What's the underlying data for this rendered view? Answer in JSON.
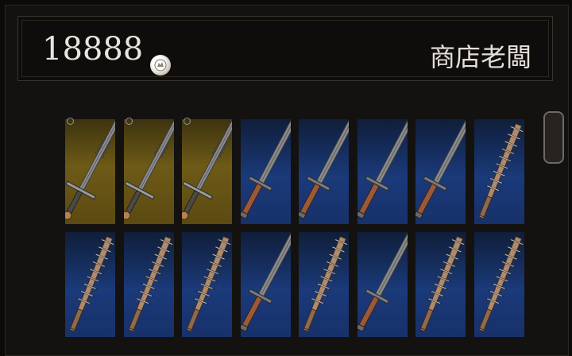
{
  "header": {
    "currency_amount": "18888",
    "currency_icon": "souls-coin-icon",
    "shop_name": "商店老闆"
  },
  "inventory": {
    "rows": [
      [
        "zweihander",
        "zweihander",
        "zweihander",
        "broadsword",
        "broadsword",
        "broadsword",
        "broadsword",
        "spiked-club"
      ],
      [
        "spiked-club",
        "spiked-club",
        "spiked-club",
        "broadsword",
        "spiked-club",
        "broadsword",
        "spiked-club",
        "spiked-club"
      ]
    ],
    "equipped_slots": [
      0,
      1,
      2
    ]
  },
  "colors": {
    "gold_slot": "#6e5a17",
    "blue_slot": "#1b3a7a",
    "text": "#e8e4de"
  }
}
